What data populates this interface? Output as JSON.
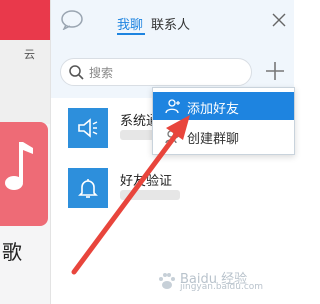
{
  "background_app": {
    "top_char": "云",
    "bottom_char": "歌"
  },
  "header": {
    "tab_my_chat": "我聊",
    "tab_contacts": "联系人"
  },
  "search": {
    "placeholder": "搜索"
  },
  "list": [
    {
      "title": "系统通知",
      "icon": "speaker-icon"
    },
    {
      "title": "好友验证",
      "icon": "bell-icon"
    }
  ],
  "dropdown": {
    "items": [
      {
        "label": "添加好友",
        "icon": "add-user-icon",
        "active": true
      },
      {
        "label": "创建群聊",
        "icon": "group-icon",
        "active": false
      }
    ]
  },
  "watermark": {
    "text": "Baidu 经验",
    "url": "jingyan.baidu.com"
  },
  "colors": {
    "accent": "#1e84e0",
    "red": "#e9394b",
    "arrow": "#e8453c"
  }
}
